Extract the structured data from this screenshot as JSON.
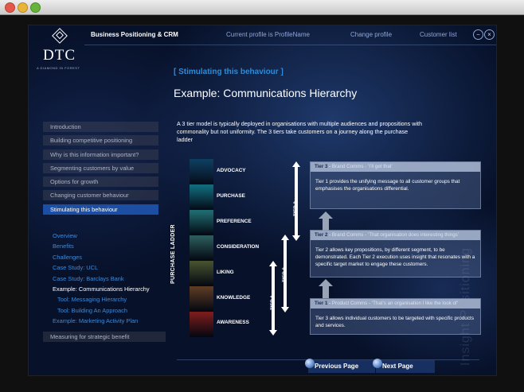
{
  "window": {
    "buttons": [
      "close",
      "minimize",
      "zoom"
    ]
  },
  "brand": {
    "logo_text": "DTC",
    "tagline": "A DIAMOND IN FOREST"
  },
  "topbar": {
    "title": "Business Positioning & CRM",
    "profile": "Current profile is ProfileName",
    "change_profile": "Change profile",
    "customer_list": "Customer list",
    "minimize_glyph": "−",
    "close_glyph": "×"
  },
  "content": {
    "section_tag": "[ Stimulating this behaviour ]",
    "title": "Example: Communications Hierarchy",
    "intro": "A 3 tier model is typically deployed in organisations with multiple audiences and propositions with commonality but not uniformity. The 3 tiers take customers on a journey along the purchase ladder"
  },
  "nav": {
    "items": [
      "Introduction",
      "Building competitive positioning",
      "Why is this information important?",
      "Segmenting customers by value",
      "Options for growth",
      "Changing customer behaviour",
      "Stimulating this behaviour"
    ],
    "sub_items": [
      "Overview",
      "Benefits",
      "Challenges",
      "Case Study: UCL",
      "Case Study: Barclays Bank",
      "Example: Communications Hierarchy",
      "Tool: Messaging Hierarchy",
      "Tool: Building An Approach",
      "Example: Marketing Activity Plan"
    ],
    "last_item": "Measuring for strategic benefit"
  },
  "diagram": {
    "ladder_label": "PURCHASE LADDER",
    "stages": [
      "ADVOCACY",
      "PURCHASE",
      "PREFERENCE",
      "CONSIDERATION",
      "LIKING",
      "KNOWLEDGE",
      "AWARENESS"
    ],
    "stage_colors": [
      "#0d3d5e",
      "#106a7a",
      "#1f6a6e",
      "#2b5a5a",
      "#44502e",
      "#5a3a24",
      "#7a1c1c"
    ],
    "tier_labels": [
      "TIER 3",
      "TIER 2",
      "TIER 1"
    ],
    "panels": [
      {
        "tier": "Tier 3",
        "sep": " - ",
        "subtitle": "Brand Comms - ‘I’ll get that’",
        "body": "Tier 1 provides the unifying message to all customer groups that emphasises the organisations differential."
      },
      {
        "tier": "Tier 2",
        "sep": " - ",
        "subtitle": "Brand Comms - ‘That organisation does interesting things’",
        "body": "Tier 2 allows key propositions, by different segment, to be demonstrated.  Each Tier 2 execution uses insight that resonates with a specific target market to engage these customers."
      },
      {
        "tier": "Tier 1",
        "sep": " - ",
        "subtitle": "Product Comms - ‘That’s an organisation I like the look of’",
        "body": "Tier 3 allows individual customers to be targeted with specific products and services."
      }
    ]
  },
  "footer": {
    "prev": "Previous Page",
    "next": "Next Page",
    "watermark": "Insight Positioning"
  }
}
